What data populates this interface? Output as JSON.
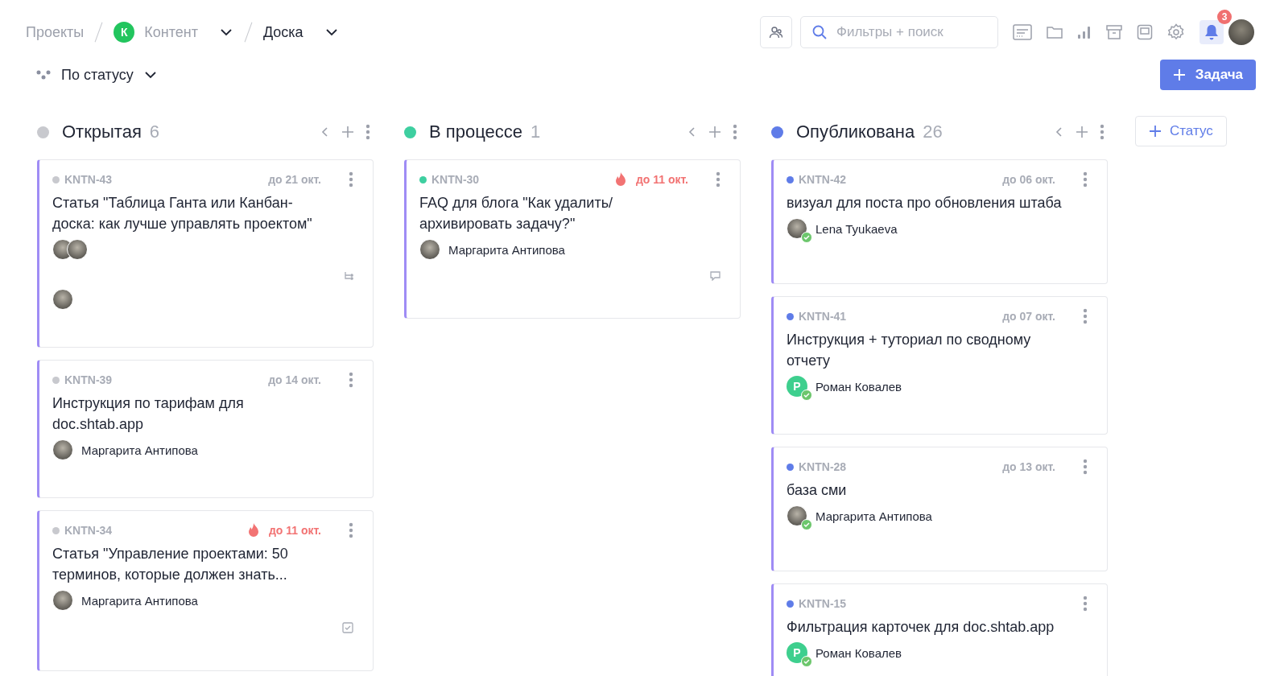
{
  "breadcrumbs": {
    "root": "Проекты",
    "project": {
      "letter": "К",
      "name": "Контент"
    },
    "view": "Доска"
  },
  "grouping": {
    "label": "По статусу"
  },
  "search": {
    "placeholder": "Фильтры + поиск"
  },
  "notifications": {
    "count": "3"
  },
  "add_task_button": {
    "label": "Задача"
  },
  "columns": [
    {
      "title": "Открытая",
      "count": "6",
      "color": "#c8c9ce",
      "cards": [
        {
          "id": "KNTN-43",
          "due": "до 21 окт.",
          "overdue": false,
          "title": "Статья \"Таблица Ганта или Канбан-доска: как лучше управлять проектом\"",
          "assignees": [
            {
              "kind": "photo",
              "confirmed": false
            },
            {
              "kind": "photo",
              "confirmed": false
            }
          ],
          "footer": {
            "kind": "subtasks"
          },
          "watchers": [
            {
              "kind": "photo"
            }
          ]
        },
        {
          "id": "KNTN-39",
          "due": "до 14 окт.",
          "overdue": false,
          "title": "Инструкция по тарифам для doc.shtab.app",
          "assignees": [
            {
              "kind": "photo",
              "name": "Маргарита Антипова",
              "confirmed": false
            }
          ]
        },
        {
          "id": "KNTN-34",
          "due": "до 11 окт.",
          "overdue": true,
          "title": "Статья \"Управление проектами: 50 терминов, которые должен знать...",
          "assignees": [
            {
              "kind": "photo",
              "name": "Маргарита Антипова",
              "confirmed": false
            }
          ],
          "footer": {
            "kind": "checklist"
          }
        }
      ]
    },
    {
      "title": "В процессе",
      "count": "1",
      "color": "#3ecfa0",
      "cards": [
        {
          "id": "KNTN-30",
          "due": "до 11 окт.",
          "overdue": true,
          "title": "FAQ для блога \"Как удалить/ архивировать задачу?\"",
          "assignees": [
            {
              "kind": "photo",
              "name": "Маргарита Антипова",
              "confirmed": false
            }
          ],
          "footer": {
            "kind": "comment"
          }
        }
      ]
    },
    {
      "title": "Опубликована",
      "count": "26",
      "color": "#5f7ce8",
      "cards": [
        {
          "id": "KNTN-42",
          "due": "до 06 окт.",
          "overdue": false,
          "title": "визуал для поста про обновления штаба",
          "assignees": [
            {
              "kind": "photo",
              "name": "Lena Tyukaeva",
              "confirmed": true
            }
          ]
        },
        {
          "id": "KNTN-41",
          "due": "до 07 окт.",
          "overdue": false,
          "title": "Инструкция + туториал по сводному отчету",
          "assignees": [
            {
              "kind": "letter",
              "letter": "Р",
              "name": "Роман Ковалев",
              "confirmed": true
            }
          ]
        },
        {
          "id": "KNTN-28",
          "due": "до 13 окт.",
          "overdue": false,
          "title": "база сми",
          "assignees": [
            {
              "kind": "photo",
              "name": "Маргарита Антипова",
              "confirmed": true
            }
          ]
        },
        {
          "id": "KNTN-15",
          "title": "Фильтрация карточек для doc.shtab.app",
          "assignees": [
            {
              "kind": "letter",
              "letter": "Р",
              "name": "Роман Ковалев",
              "confirmed": true
            }
          ]
        }
      ]
    }
  ],
  "add_status_button": {
    "label": "Статус"
  }
}
